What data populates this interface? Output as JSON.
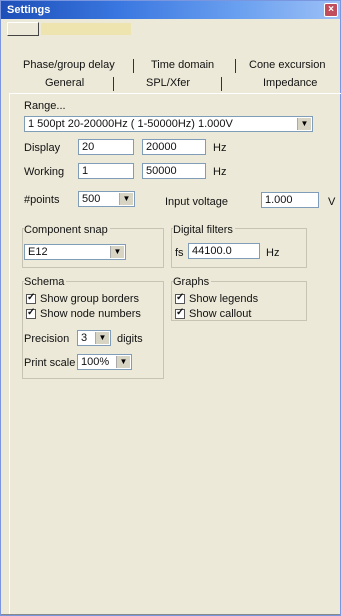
{
  "window": {
    "title": "Settings",
    "close_icon": "close-icon"
  },
  "tabs_top": [
    "Phase/group delay",
    "Time domain",
    "Cone excursion"
  ],
  "tabs_bottom": [
    "General",
    "SPL/Xfer",
    "Impedance"
  ],
  "range": {
    "label": "Range...",
    "selected": "1 500pt 20-20000Hz ( 1-50000Hz) 1.000V"
  },
  "display": {
    "label": "Display",
    "low": "20",
    "high": "20000",
    "unit": "Hz"
  },
  "working": {
    "label": "Working",
    "low": "1",
    "high": "50000",
    "unit": "Hz"
  },
  "points": {
    "label": "#points",
    "value": "500"
  },
  "input_voltage": {
    "label": "Input voltage",
    "value": "1.000",
    "unit": "V"
  },
  "component_snap": {
    "label": "Component snap",
    "value": "E12"
  },
  "digital_filters": {
    "label": "Digital filters",
    "fs_label": "fs",
    "value": "44100.0",
    "unit": "Hz"
  },
  "schema": {
    "label": "Schema",
    "options": [
      {
        "label": "Show group borders",
        "checked": true
      },
      {
        "label": "Show node numbers",
        "checked": true
      }
    ]
  },
  "graphs": {
    "label": "Graphs",
    "options": [
      {
        "label": "Show legends",
        "checked": true
      },
      {
        "label": "Show callout",
        "checked": true
      }
    ]
  },
  "precision": {
    "label": "Precision",
    "value": "3",
    "suffix": "digits"
  },
  "print_scale": {
    "label": "Print scale",
    "value": "100%"
  }
}
